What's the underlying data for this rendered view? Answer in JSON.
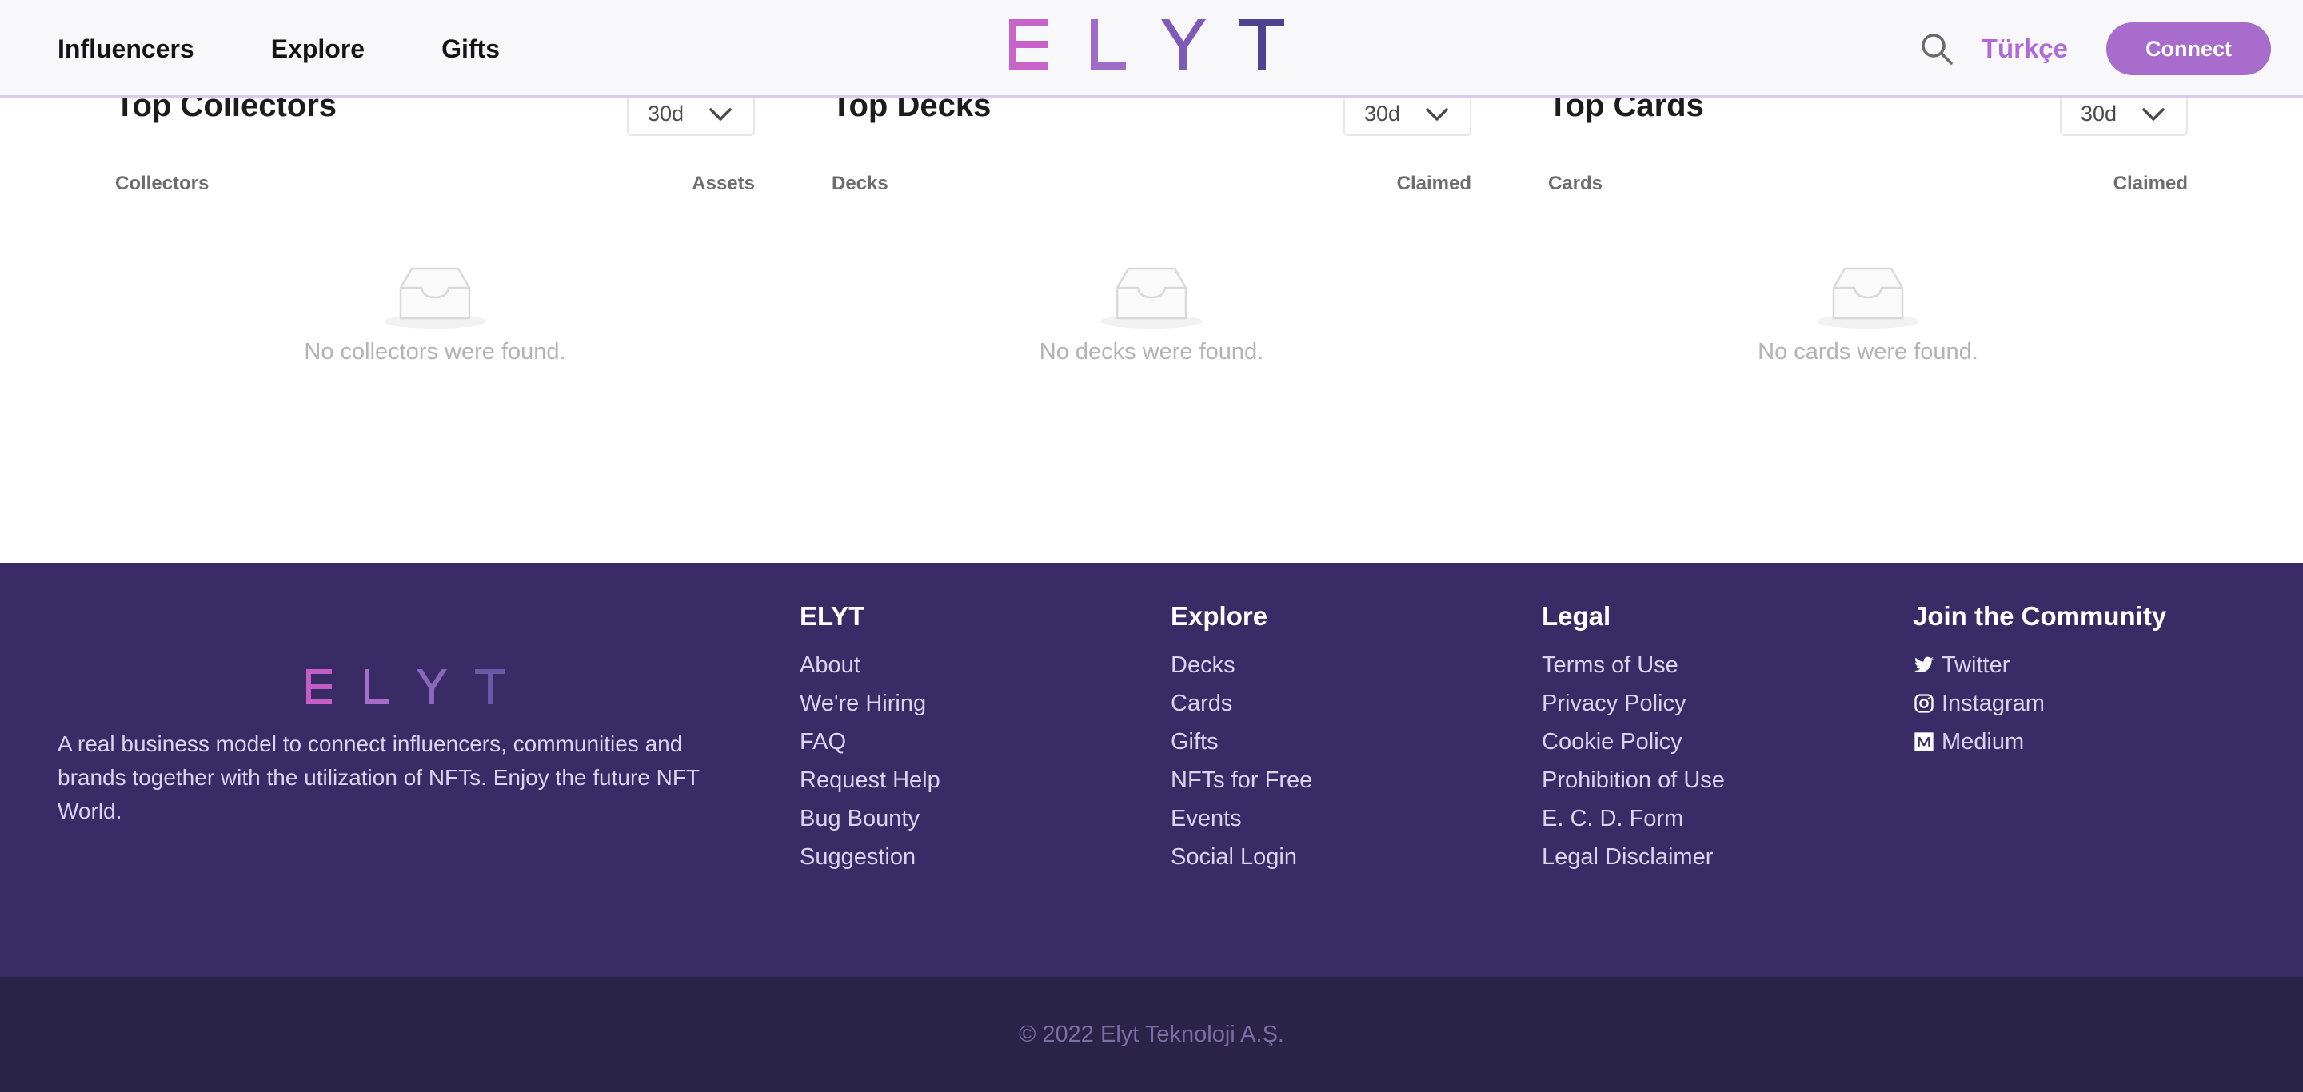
{
  "header": {
    "nav": [
      "Influencers",
      "Explore",
      "Gifts"
    ],
    "brand": "ELYT",
    "language": "Türkçe",
    "connect_label": "Connect",
    "search_icon": "search-icon"
  },
  "sections": [
    {
      "title": "Top Collectors",
      "period": "30d",
      "col_left": "Collectors",
      "col_right": "Assets",
      "empty": "No collectors were found."
    },
    {
      "title": "Top Decks",
      "period": "30d",
      "col_left": "Decks",
      "col_right": "Claimed",
      "empty": "No decks were found."
    },
    {
      "title": "Top Cards",
      "period": "30d",
      "col_left": "Cards",
      "col_right": "Claimed",
      "empty": "No cards were found."
    }
  ],
  "footer": {
    "brand": "ELYT",
    "description": "A real business model to connect influencers, communities and brands together with the utilization of NFTs. Enjoy the future NFT World.",
    "columns": [
      {
        "title": "ELYT",
        "links": [
          "About",
          "We're Hiring",
          "FAQ",
          "Request Help",
          "Bug Bounty",
          "Suggestion"
        ]
      },
      {
        "title": "Explore",
        "links": [
          "Decks",
          "Cards",
          "Gifts",
          "NFTs for Free",
          "Events",
          "Social Login"
        ]
      },
      {
        "title": "Legal",
        "links": [
          "Terms of Use",
          "Privacy Policy",
          "Cookie Policy",
          "Prohibition of Use",
          "E. C. D. Form",
          "Legal Disclaimer"
        ]
      },
      {
        "title": "Join the Community",
        "links": [
          "Twitter",
          "Instagram",
          "Medium"
        ]
      }
    ],
    "copyright": "© 2022 Elyt Teknoloji A.Ş."
  },
  "colors": {
    "accent": "#a76ccc",
    "footer_bg": "#392b65",
    "copyright_bg": "#2a2348"
  }
}
